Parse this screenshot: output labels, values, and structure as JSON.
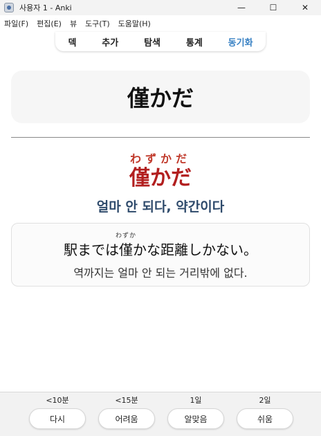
{
  "window": {
    "title": "사용자 1 - Anki",
    "minimize_glyph": "—",
    "maximize_glyph": "☐",
    "close_glyph": "✕"
  },
  "menu": [
    "파일(F)",
    "편집(E)",
    "뷰",
    "도구(T)",
    "도움말(H)"
  ],
  "toolbar": {
    "deck": "덱",
    "add": "추가",
    "browse": "탐색",
    "stats": "통계",
    "sync": "동기화"
  },
  "card": {
    "question": "僅かだ",
    "reading": "わずかだ",
    "answer": "僅かだ",
    "meaning": "얼마 안 되다, 약간이다",
    "example_ruby": "わずか",
    "example_sentence": "駅までは僅かな距離しかない。",
    "example_translation": "역까지는 얼마 안 되는 거리밖에 없다."
  },
  "answer_buttons": [
    {
      "time": "<10분",
      "label": "다시"
    },
    {
      "time": "<15분",
      "label": "어려움"
    },
    {
      "time": "1일",
      "label": "알맞음"
    },
    {
      "time": "2일",
      "label": "쉬움"
    }
  ],
  "colors": {
    "answer_red": "#b21f1f",
    "meaning_blue": "#2e4a6b",
    "sync_blue": "#3a82c4"
  },
  "icons": [
    "anki-app-icon"
  ]
}
